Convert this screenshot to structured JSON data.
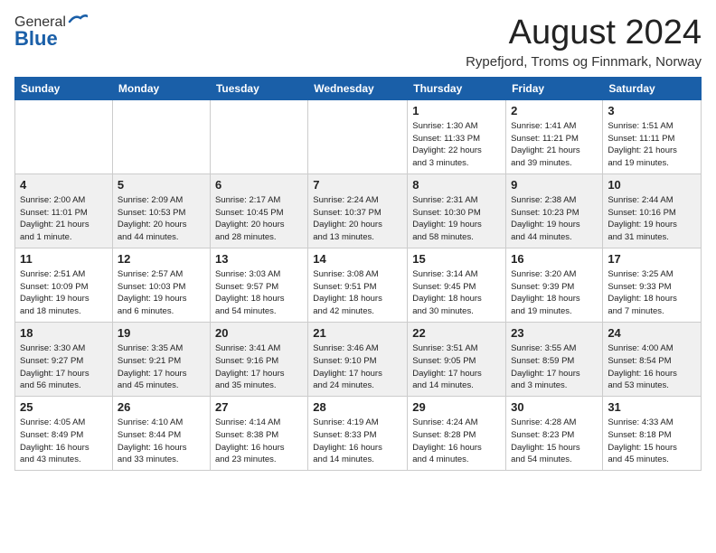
{
  "header": {
    "logo_general": "General",
    "logo_blue": "Blue",
    "month_title": "August 2024",
    "subtitle": "Rypefjord, Troms og Finnmark, Norway"
  },
  "weekdays": [
    "Sunday",
    "Monday",
    "Tuesday",
    "Wednesday",
    "Thursday",
    "Friday",
    "Saturday"
  ],
  "weeks": [
    [
      {
        "day": "",
        "info": ""
      },
      {
        "day": "",
        "info": ""
      },
      {
        "day": "",
        "info": ""
      },
      {
        "day": "",
        "info": ""
      },
      {
        "day": "1",
        "info": "Sunrise: 1:30 AM\nSunset: 11:33 PM\nDaylight: 22 hours\nand 3 minutes."
      },
      {
        "day": "2",
        "info": "Sunrise: 1:41 AM\nSunset: 11:21 PM\nDaylight: 21 hours\nand 39 minutes."
      },
      {
        "day": "3",
        "info": "Sunrise: 1:51 AM\nSunset: 11:11 PM\nDaylight: 21 hours\nand 19 minutes."
      }
    ],
    [
      {
        "day": "4",
        "info": "Sunrise: 2:00 AM\nSunset: 11:01 PM\nDaylight: 21 hours\nand 1 minute."
      },
      {
        "day": "5",
        "info": "Sunrise: 2:09 AM\nSunset: 10:53 PM\nDaylight: 20 hours\nand 44 minutes."
      },
      {
        "day": "6",
        "info": "Sunrise: 2:17 AM\nSunset: 10:45 PM\nDaylight: 20 hours\nand 28 minutes."
      },
      {
        "day": "7",
        "info": "Sunrise: 2:24 AM\nSunset: 10:37 PM\nDaylight: 20 hours\nand 13 minutes."
      },
      {
        "day": "8",
        "info": "Sunrise: 2:31 AM\nSunset: 10:30 PM\nDaylight: 19 hours\nand 58 minutes."
      },
      {
        "day": "9",
        "info": "Sunrise: 2:38 AM\nSunset: 10:23 PM\nDaylight: 19 hours\nand 44 minutes."
      },
      {
        "day": "10",
        "info": "Sunrise: 2:44 AM\nSunset: 10:16 PM\nDaylight: 19 hours\nand 31 minutes."
      }
    ],
    [
      {
        "day": "11",
        "info": "Sunrise: 2:51 AM\nSunset: 10:09 PM\nDaylight: 19 hours\nand 18 minutes."
      },
      {
        "day": "12",
        "info": "Sunrise: 2:57 AM\nSunset: 10:03 PM\nDaylight: 19 hours\nand 6 minutes."
      },
      {
        "day": "13",
        "info": "Sunrise: 3:03 AM\nSunset: 9:57 PM\nDaylight: 18 hours\nand 54 minutes."
      },
      {
        "day": "14",
        "info": "Sunrise: 3:08 AM\nSunset: 9:51 PM\nDaylight: 18 hours\nand 42 minutes."
      },
      {
        "day": "15",
        "info": "Sunrise: 3:14 AM\nSunset: 9:45 PM\nDaylight: 18 hours\nand 30 minutes."
      },
      {
        "day": "16",
        "info": "Sunrise: 3:20 AM\nSunset: 9:39 PM\nDaylight: 18 hours\nand 19 minutes."
      },
      {
        "day": "17",
        "info": "Sunrise: 3:25 AM\nSunset: 9:33 PM\nDaylight: 18 hours\nand 7 minutes."
      }
    ],
    [
      {
        "day": "18",
        "info": "Sunrise: 3:30 AM\nSunset: 9:27 PM\nDaylight: 17 hours\nand 56 minutes."
      },
      {
        "day": "19",
        "info": "Sunrise: 3:35 AM\nSunset: 9:21 PM\nDaylight: 17 hours\nand 45 minutes."
      },
      {
        "day": "20",
        "info": "Sunrise: 3:41 AM\nSunset: 9:16 PM\nDaylight: 17 hours\nand 35 minutes."
      },
      {
        "day": "21",
        "info": "Sunrise: 3:46 AM\nSunset: 9:10 PM\nDaylight: 17 hours\nand 24 minutes."
      },
      {
        "day": "22",
        "info": "Sunrise: 3:51 AM\nSunset: 9:05 PM\nDaylight: 17 hours\nand 14 minutes."
      },
      {
        "day": "23",
        "info": "Sunrise: 3:55 AM\nSunset: 8:59 PM\nDaylight: 17 hours\nand 3 minutes."
      },
      {
        "day": "24",
        "info": "Sunrise: 4:00 AM\nSunset: 8:54 PM\nDaylight: 16 hours\nand 53 minutes."
      }
    ],
    [
      {
        "day": "25",
        "info": "Sunrise: 4:05 AM\nSunset: 8:49 PM\nDaylight: 16 hours\nand 43 minutes."
      },
      {
        "day": "26",
        "info": "Sunrise: 4:10 AM\nSunset: 8:44 PM\nDaylight: 16 hours\nand 33 minutes."
      },
      {
        "day": "27",
        "info": "Sunrise: 4:14 AM\nSunset: 8:38 PM\nDaylight: 16 hours\nand 23 minutes."
      },
      {
        "day": "28",
        "info": "Sunrise: 4:19 AM\nSunset: 8:33 PM\nDaylight: 16 hours\nand 14 minutes."
      },
      {
        "day": "29",
        "info": "Sunrise: 4:24 AM\nSunset: 8:28 PM\nDaylight: 16 hours\nand 4 minutes."
      },
      {
        "day": "30",
        "info": "Sunrise: 4:28 AM\nSunset: 8:23 PM\nDaylight: 15 hours\nand 54 minutes."
      },
      {
        "day": "31",
        "info": "Sunrise: 4:33 AM\nSunset: 8:18 PM\nDaylight: 15 hours\nand 45 minutes."
      }
    ]
  ]
}
